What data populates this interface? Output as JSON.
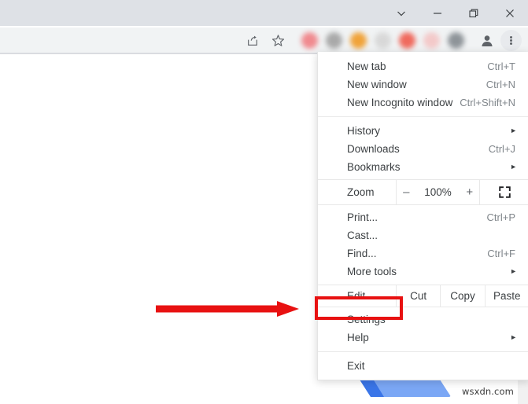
{
  "window": {
    "controls": [
      {
        "name": "chevron-down",
        "glyph": "v"
      },
      {
        "name": "minimize",
        "glyph": "-"
      },
      {
        "name": "maximize",
        "glyph": "restore"
      },
      {
        "name": "close",
        "glyph": "x"
      }
    ]
  },
  "toolbar": {
    "share_icon": "share-icon",
    "bookmark_icon": "star-icon",
    "extension_colors": [
      "#f08a8f",
      "#a9a9a9",
      "#f0a33a",
      "#d8d8d8",
      "#ef6a5e",
      "#f3c9c9",
      "#8e9499"
    ],
    "profile_icon": "profile-avatar-icon",
    "menu_icon": "three-dot-menu-icon"
  },
  "menu": {
    "groups": [
      {
        "items": [
          {
            "label": "New tab",
            "accel": "Ctrl+T",
            "submenu": false
          },
          {
            "label": "New window",
            "accel": "Ctrl+N",
            "submenu": false
          },
          {
            "label": "New Incognito window",
            "accel": "Ctrl+Shift+N",
            "submenu": false
          }
        ]
      },
      {
        "items": [
          {
            "label": "History",
            "accel": "",
            "submenu": true
          },
          {
            "label": "Downloads",
            "accel": "Ctrl+J",
            "submenu": false
          },
          {
            "label": "Bookmarks",
            "accel": "",
            "submenu": true
          }
        ]
      }
    ],
    "zoom_row": {
      "label": "Zoom",
      "minus": "–",
      "value": "100%",
      "plus": "+",
      "fullscreen_icon": "fullscreen-icon"
    },
    "tools_group": [
      {
        "label": "Print...",
        "accel": "Ctrl+P",
        "submenu": false
      },
      {
        "label": "Cast...",
        "accel": "",
        "submenu": false
      },
      {
        "label": "Find...",
        "accel": "Ctrl+F",
        "submenu": false
      },
      {
        "label": "More tools",
        "accel": "",
        "submenu": true
      }
    ],
    "edit_row": {
      "label": "Edit",
      "actions": [
        "Cut",
        "Copy",
        "Paste"
      ]
    },
    "settings_group": [
      {
        "label": "Settings",
        "accel": "",
        "submenu": false
      },
      {
        "label": "Help",
        "accel": "",
        "submenu": true
      }
    ],
    "exit_group": [
      {
        "label": "Exit",
        "accel": "",
        "submenu": false
      }
    ]
  },
  "annotation": {
    "highlight_target": "Settings",
    "highlight_color": "#e81111",
    "arrow_color": "#e81111",
    "arrow_direction": "right"
  },
  "page": {
    "watermark": "wsxdn.com",
    "logo_colors": [
      "#3a75e8",
      "#7ba7f5"
    ]
  }
}
